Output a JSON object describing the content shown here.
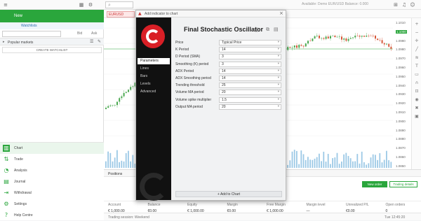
{
  "topbar": {
    "search_placeholder": "",
    "right_text": "Available: Demo EUR/USD  Balance: 0.000",
    "icons": [
      "grid-icon",
      "expand-icon",
      "bell-icon",
      "user-icon"
    ]
  },
  "left_panel": {
    "new_label": "New",
    "watchlists_label": "Watchlists",
    "popular_markets": "Popular markets",
    "create_watchlist": "CREATE WATCHLIST",
    "nav": [
      {
        "label": "Chart",
        "icon": "chart-icon"
      },
      {
        "label": "Trade",
        "icon": "trade-icon"
      },
      {
        "label": "Analysis",
        "icon": "analysis-icon"
      },
      {
        "label": "Journal",
        "icon": "journal-icon"
      },
      {
        "label": "Withdrawal",
        "icon": "withdrawal-icon"
      },
      {
        "label": "Settings",
        "icon": "settings-icon"
      },
      {
        "label": "Help Centre",
        "icon": "help-icon"
      }
    ]
  },
  "chart": {
    "tab_label": "EURUSD",
    "price_labels": [
      "1.1010",
      "1.1000",
      "1.0990",
      "1.0980",
      "1.0970",
      "1.0960",
      "1.0950",
      "1.0940",
      "1.0930",
      "1.0920",
      "1.0910",
      "1.0900",
      "1.0890",
      "1.0880",
      "1.0870",
      "1.0860",
      "1.0850"
    ],
    "highlight_price": "1.1000"
  },
  "dialog": {
    "title_bar": "Add indicator to chart",
    "heading": "Final Stochastic Oscillator",
    "nav": [
      "Parameters",
      "Lines",
      "Bars",
      "Levels",
      "Advanced"
    ],
    "params": [
      {
        "label": "Price",
        "value": "Typical Price"
      },
      {
        "label": "K Period",
        "value": "14"
      },
      {
        "label": "D Period (SMA)",
        "value": "3"
      },
      {
        "label": "Smoothing (K) period",
        "value": "3"
      },
      {
        "label": "ADX Period",
        "value": "14"
      },
      {
        "label": "ADX Smoothing period",
        "value": "14"
      },
      {
        "label": "Trending threshold",
        "value": "25"
      },
      {
        "label": "Volume MA period",
        "value": "20"
      },
      {
        "label": "Volume spike multiplier",
        "value": "1.5"
      },
      {
        "label": "Output MA period",
        "value": "20"
      }
    ],
    "add_button": "+ Add to Chart"
  },
  "bottom": {
    "positions_tab": "Positions",
    "new_order": "New order",
    "trading_details": "Trading details",
    "headers": [
      "Account",
      "Balance",
      "Equity",
      "Margin",
      "Free Margin",
      "Margin level",
      "Unrealized P/L",
      "Open orders"
    ],
    "values": [
      "€ 1,000.00",
      "€0.00",
      "€ 1,000.00",
      "€0.00",
      "€ 1,000.00",
      "—",
      "€0.00",
      "0"
    ]
  },
  "statusbar": {
    "left": "Trading session: Weekend",
    "right": "Tue 12:45:20"
  }
}
